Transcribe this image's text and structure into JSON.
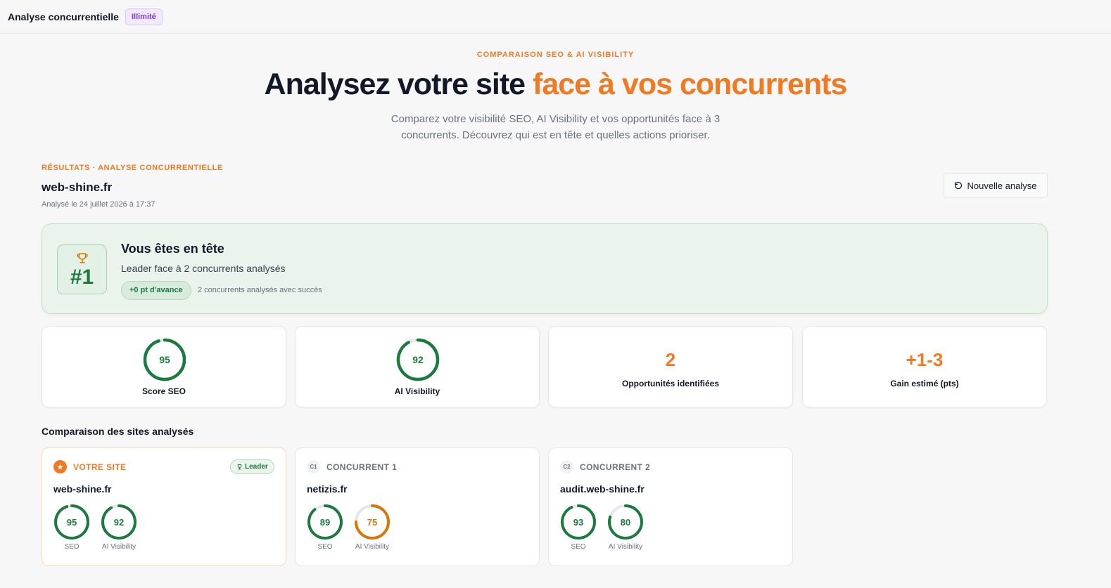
{
  "app": {
    "title": "Analyse concurrentielle",
    "plan_badge": "Illimité"
  },
  "hero": {
    "eyebrow": "COMPARAISON SEO & AI VISIBILITY",
    "title_part1": "Analysez votre site ",
    "title_accent": "face à vos concurrents",
    "subtitle": "Comparez votre visibilité SEO, AI Visibility et vos opportunités face à 3 concurrents. Découvrez qui est en tête et quelles actions prioriser."
  },
  "results": {
    "eyebrow": "RÉSULTATS · ANALYSE CONCURRENTIELLE",
    "domain": "web-shine.fr",
    "analyzed_at": "Analysé le 24 juillet 2026 à 17:37",
    "new_analysis_label": "Nouvelle analyse"
  },
  "banner": {
    "rank": "#1",
    "title": "Vous êtes en tête",
    "subtitle": "Leader face à 2 concurrents analysés",
    "lead_pill": "+0 pt d'avance",
    "note": "2 concurrents analysés avec succès"
  },
  "kpis": {
    "seo": {
      "value": "95",
      "label": "Score SEO",
      "progress": 0.95
    },
    "ai": {
      "value": "92",
      "label": "AI Visibility",
      "progress": 0.92
    },
    "opportunities": {
      "value": "2",
      "label": "Opportunités identifiées"
    },
    "gain": {
      "value": "+1-3",
      "label": "Gain estimé (pts)"
    }
  },
  "comparison": {
    "title": "Comparaison des sites analysés",
    "metric_labels": {
      "seo": "SEO",
      "ai": "AI Visibility"
    },
    "sites": [
      {
        "tag": "VOTRE SITE",
        "badge": "Leader",
        "domain": "web-shine.fr",
        "seo": "95",
        "ai": "92",
        "seo_progress": 0.95,
        "ai_progress": 0.92
      },
      {
        "tag": "CONCURRENT 1",
        "badge": "C1",
        "domain": "netizis.fr",
        "seo": "89",
        "ai": "75",
        "seo_progress": 0.89,
        "ai_progress": 0.75
      },
      {
        "tag": "CONCURRENT 2",
        "badge": "C2",
        "domain": "audit.web-shine.fr",
        "seo": "93",
        "ai": "80",
        "seo_progress": 0.93,
        "ai_progress": 0.8
      }
    ]
  },
  "colors": {
    "accent": "#f07a21",
    "success": "#1b7a3d",
    "warning": "#d97706",
    "ring_track": "#e5e7eb",
    "plan": "#7c3aed"
  },
  "icons": {
    "new_analysis": "refresh-icon",
    "rank": "trophy-icon",
    "own_site": "star-icon",
    "leader": "trophy-icon"
  }
}
